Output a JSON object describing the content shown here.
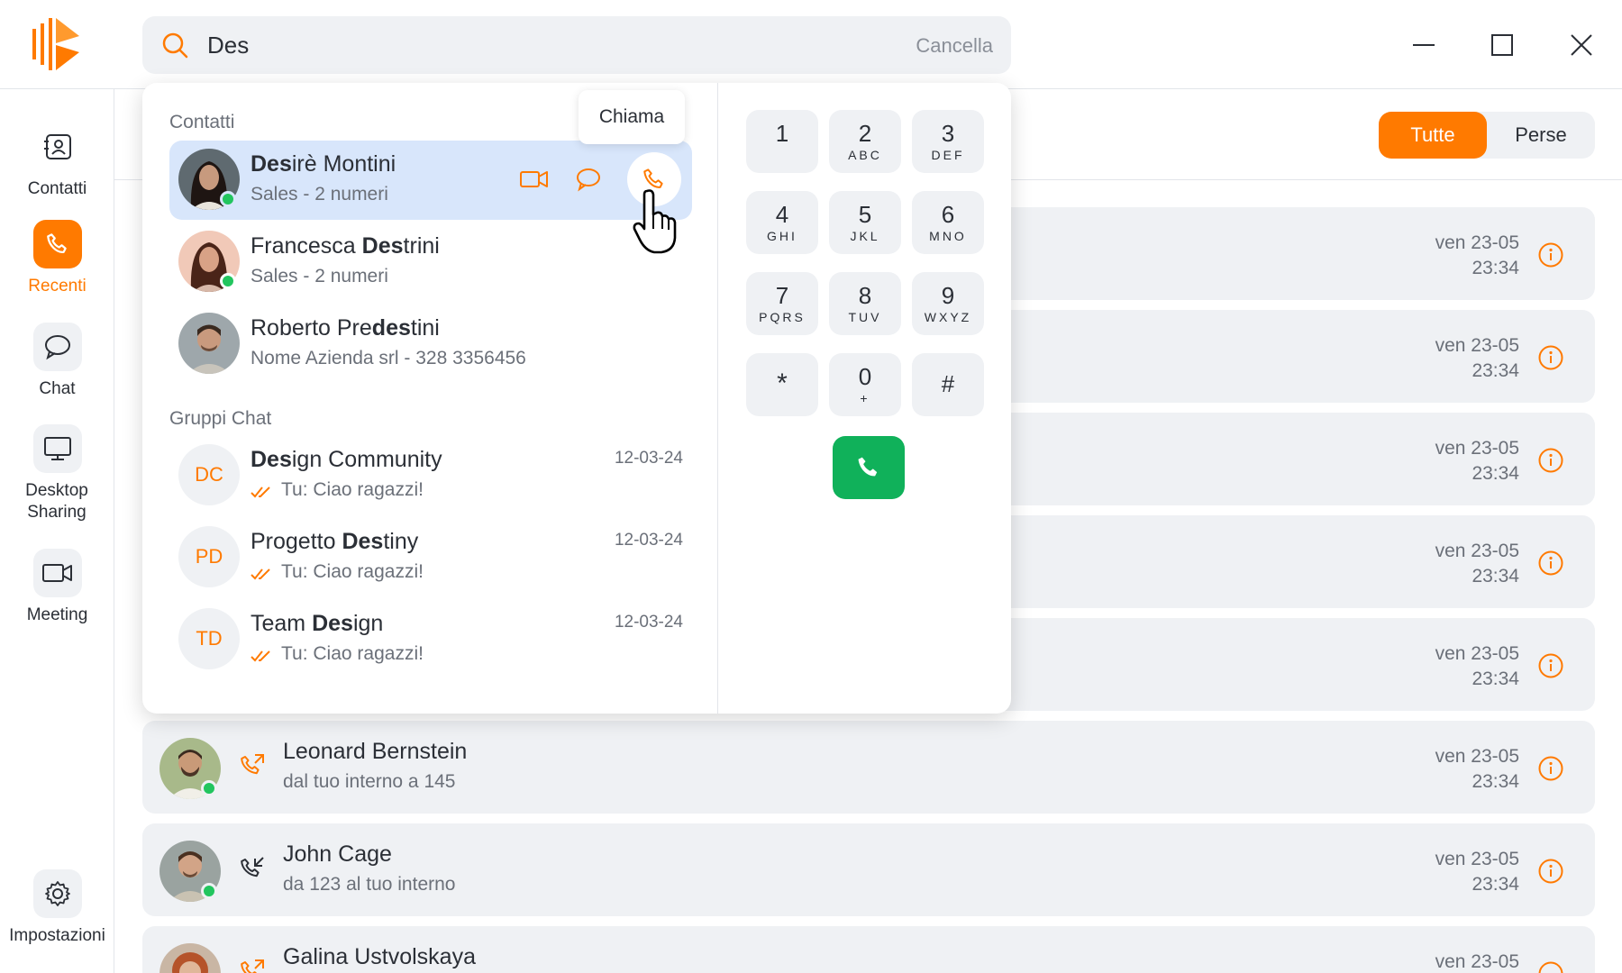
{
  "search": {
    "value": "Des",
    "clear_label": "Cancella"
  },
  "sidebar": {
    "items": [
      {
        "label": "Contatti"
      },
      {
        "label": "Recenti"
      },
      {
        "label": "Chat"
      },
      {
        "label": "Desktop Sharing"
      },
      {
        "label": "Meeting"
      },
      {
        "label": "Impostazioni"
      }
    ]
  },
  "filter": {
    "all": "Tutte",
    "missed": "Perse"
  },
  "calls": [
    {
      "date": "ven 23-05",
      "time": "23:34"
    },
    {
      "date": "ven 23-05",
      "time": "23:34"
    },
    {
      "date": "ven 23-05",
      "time": "23:34"
    },
    {
      "date": "ven 23-05",
      "time": "23:34"
    },
    {
      "date": "ven 23-05",
      "time": "23:34"
    },
    {
      "name": "Leonard Bernstein",
      "sub": "dal tuo interno a 145",
      "date": "ven 23-05",
      "time": "23:34"
    },
    {
      "name": "John Cage",
      "sub": "da 123 al tuo interno",
      "date": "ven 23-05",
      "time": "23:34"
    },
    {
      "name": "Galina Ustvolskaya",
      "date": "ven 23-05"
    }
  ],
  "panel": {
    "contacts_heading": "Contatti",
    "groups_heading": "Gruppi Chat",
    "tooltip": "Chiama",
    "contacts": [
      {
        "bold": "Des",
        "rest": "irè Montini",
        "sub": "Sales - 2 numeri"
      },
      {
        "pre": "Francesca ",
        "bold": "Des",
        "rest": "trini",
        "sub": "Sales - 2 numeri"
      },
      {
        "pre": "Roberto Pre",
        "bold": "des",
        "rest": "tini",
        "sub": "Nome Azienda srl - 328 3356456"
      }
    ],
    "groups": [
      {
        "initials": "DC",
        "bold": "Des",
        "rest": "ign Community",
        "date": "12-03-24",
        "msg": "Tu: Ciao ragazzi!"
      },
      {
        "initials": "PD",
        "pre": "Progetto ",
        "bold": "Des",
        "rest": "tiny",
        "date": "12-03-24",
        "msg": "Tu: Ciao ragazzi!"
      },
      {
        "initials": "TD",
        "pre": "Team ",
        "bold": "Des",
        "rest": "ign",
        "date": "12-03-24",
        "msg": "Tu: Ciao ragazzi!"
      }
    ]
  },
  "dialpad": [
    {
      "digit": "1",
      "letters": ""
    },
    {
      "digit": "2",
      "letters": "ABC"
    },
    {
      "digit": "3",
      "letters": "DEF"
    },
    {
      "digit": "4",
      "letters": "GHI"
    },
    {
      "digit": "5",
      "letters": "JKL"
    },
    {
      "digit": "6",
      "letters": "MNO"
    },
    {
      "digit": "7",
      "letters": "PQRS"
    },
    {
      "digit": "8",
      "letters": "TUV"
    },
    {
      "digit": "9",
      "letters": "WXYZ"
    },
    {
      "digit": "*",
      "letters": ""
    },
    {
      "digit": "0",
      "letters": "+"
    },
    {
      "digit": "#",
      "letters": ""
    }
  ],
  "colors": {
    "accent": "#ff7a00",
    "online": "#22c55e",
    "call_green": "#10b15a",
    "highlight": "#d8e6fb",
    "row_bg": "#eff1f4"
  }
}
